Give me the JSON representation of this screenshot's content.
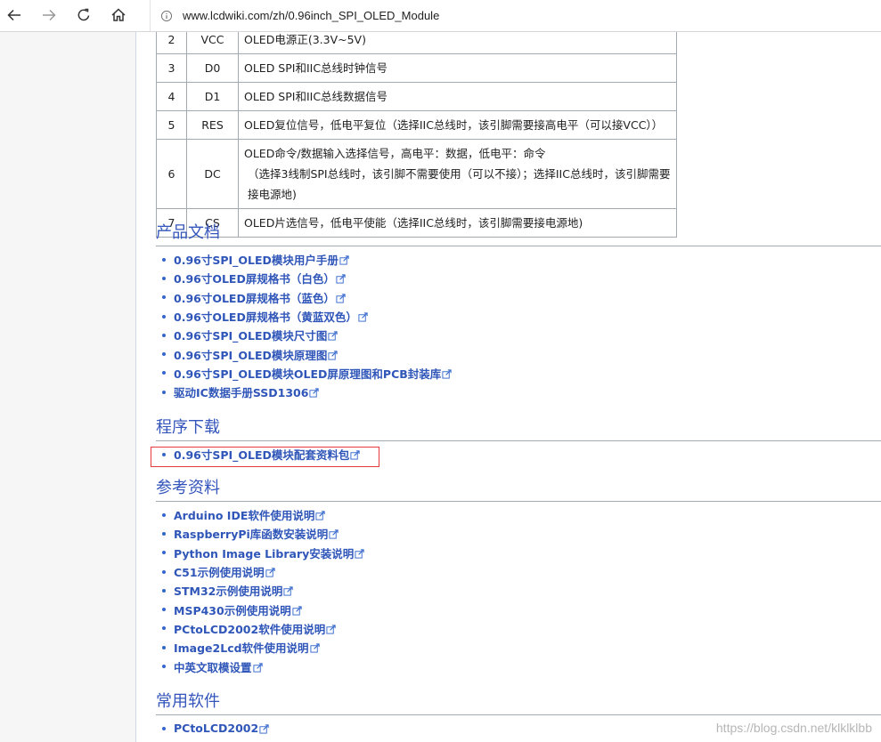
{
  "browser": {
    "url": "www.lcdwiki.com/zh/0.96inch_SPI_OLED_Module",
    "icons": [
      "back-icon",
      "forward-icon",
      "refresh-icon",
      "home-icon",
      "info-icon"
    ]
  },
  "pin_table": {
    "rows": [
      {
        "num": "2",
        "name": "VCC",
        "desc": [
          "OLED电源正(3.3V~5V)"
        ]
      },
      {
        "num": "3",
        "name": "D0",
        "desc": [
          "OLED SPI和IIC总线时钟信号"
        ]
      },
      {
        "num": "4",
        "name": "D1",
        "desc": [
          "OLED SPI和IIC总线数据信号"
        ]
      },
      {
        "num": "5",
        "name": "RES",
        "desc": [
          "OLED复位信号，低电平复位（选择IIC总线时，该引脚需要接高电平（可以接VCC））"
        ]
      },
      {
        "num": "6",
        "name": "DC",
        "desc": [
          "OLED命令/数据输入选择信号，高电平：数据，低电平：命令",
          "（选择3线制SPI总线时，该引脚不需要使用（可以不接）；选择IIC总线时，该引脚需要接电源地)"
        ]
      },
      {
        "num": "7",
        "name": "CS",
        "desc": [
          "OLED片选信号，低电平使能（选择IIC总线时，该引脚需要接电源地)"
        ]
      }
    ]
  },
  "sections": {
    "docs": {
      "title": "产品文档",
      "links": [
        "0.96寸SPI_OLED模块用户手册",
        "0.96寸OLED屏规格书（白色）",
        "0.96寸OLED屏规格书（蓝色）",
        "0.96寸OLED屏规格书（黄蓝双色）",
        "0.96寸SPI_OLED模块尺寸图",
        "0.96寸SPI_OLED模块原理图",
        "0.96寸SPI_OLED模块OLED屏原理图和PCB封装库",
        "驱动IC数据手册SSD1306"
      ]
    },
    "download": {
      "title": "程序下载",
      "links": [
        "0.96寸SPI_OLED模块配套资料包"
      ]
    },
    "refs": {
      "title": "参考资料",
      "links": [
        "Arduino IDE软件使用说明",
        "RaspberryPi库函数安装说明",
        "Python Image Library安装说明",
        "C51示例使用说明",
        "STM32示例使用说明",
        "MSP430示例使用说明",
        "PCtoLCD2002软件使用说明",
        "Image2Lcd软件使用说明",
        "中英文取模设置"
      ]
    },
    "software": {
      "title": "常用软件",
      "links": [
        "PCtoLCD2002"
      ]
    }
  },
  "watermark": "https://blog.csdn.net/klklklbb",
  "colors": {
    "link": "#2f56b8",
    "heading": "#3355bb",
    "highlight": "#e43a3a"
  }
}
